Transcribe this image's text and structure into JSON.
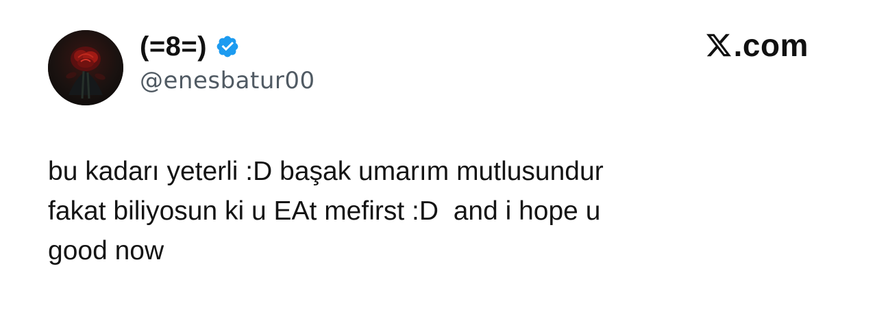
{
  "tweet": {
    "author": {
      "display_name": "(=8=)",
      "handle": "@enesbatur00",
      "verified": true,
      "verified_badge_color": "#1d9bf0",
      "avatar_icon": "avatar-icon"
    },
    "brand": {
      "logo_icon": "x-logo-icon",
      "text": ".com"
    },
    "body": "bu kadarı yeterli :D başak umarım mutlusundur\nfakat biliyosun ki u EAt mefirst :D  and i hope u\ngood now"
  }
}
